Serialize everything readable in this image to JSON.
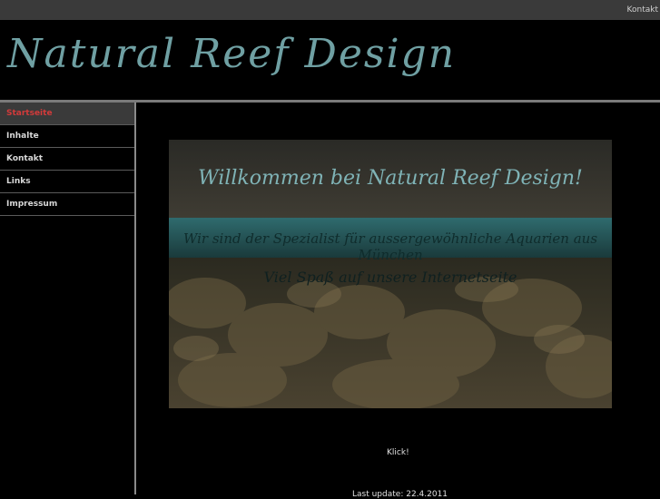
{
  "topbar": {
    "kontakt_link": "Kontakt"
  },
  "header": {
    "logo_text": "Natural Reef Design"
  },
  "sidebar": {
    "items": [
      {
        "label": "Startseite"
      },
      {
        "label": "Inhalte"
      },
      {
        "label": "Kontakt"
      },
      {
        "label": "Links"
      },
      {
        "label": "Impressum"
      }
    ]
  },
  "main": {
    "banner": {
      "line1": "Willkommen bei Natural Reef Design!",
      "line2": "Wir sind der Spezialist für aussergewöhnliche Aquarien aus München",
      "line3": "Viel Spaß auf unsere Internetseite"
    },
    "klick": "Klick!",
    "last_update": "Last update: 22.4.2011"
  },
  "colors": {
    "accent": "#6fa0a3",
    "active_nav_text": "#d23a3a"
  }
}
